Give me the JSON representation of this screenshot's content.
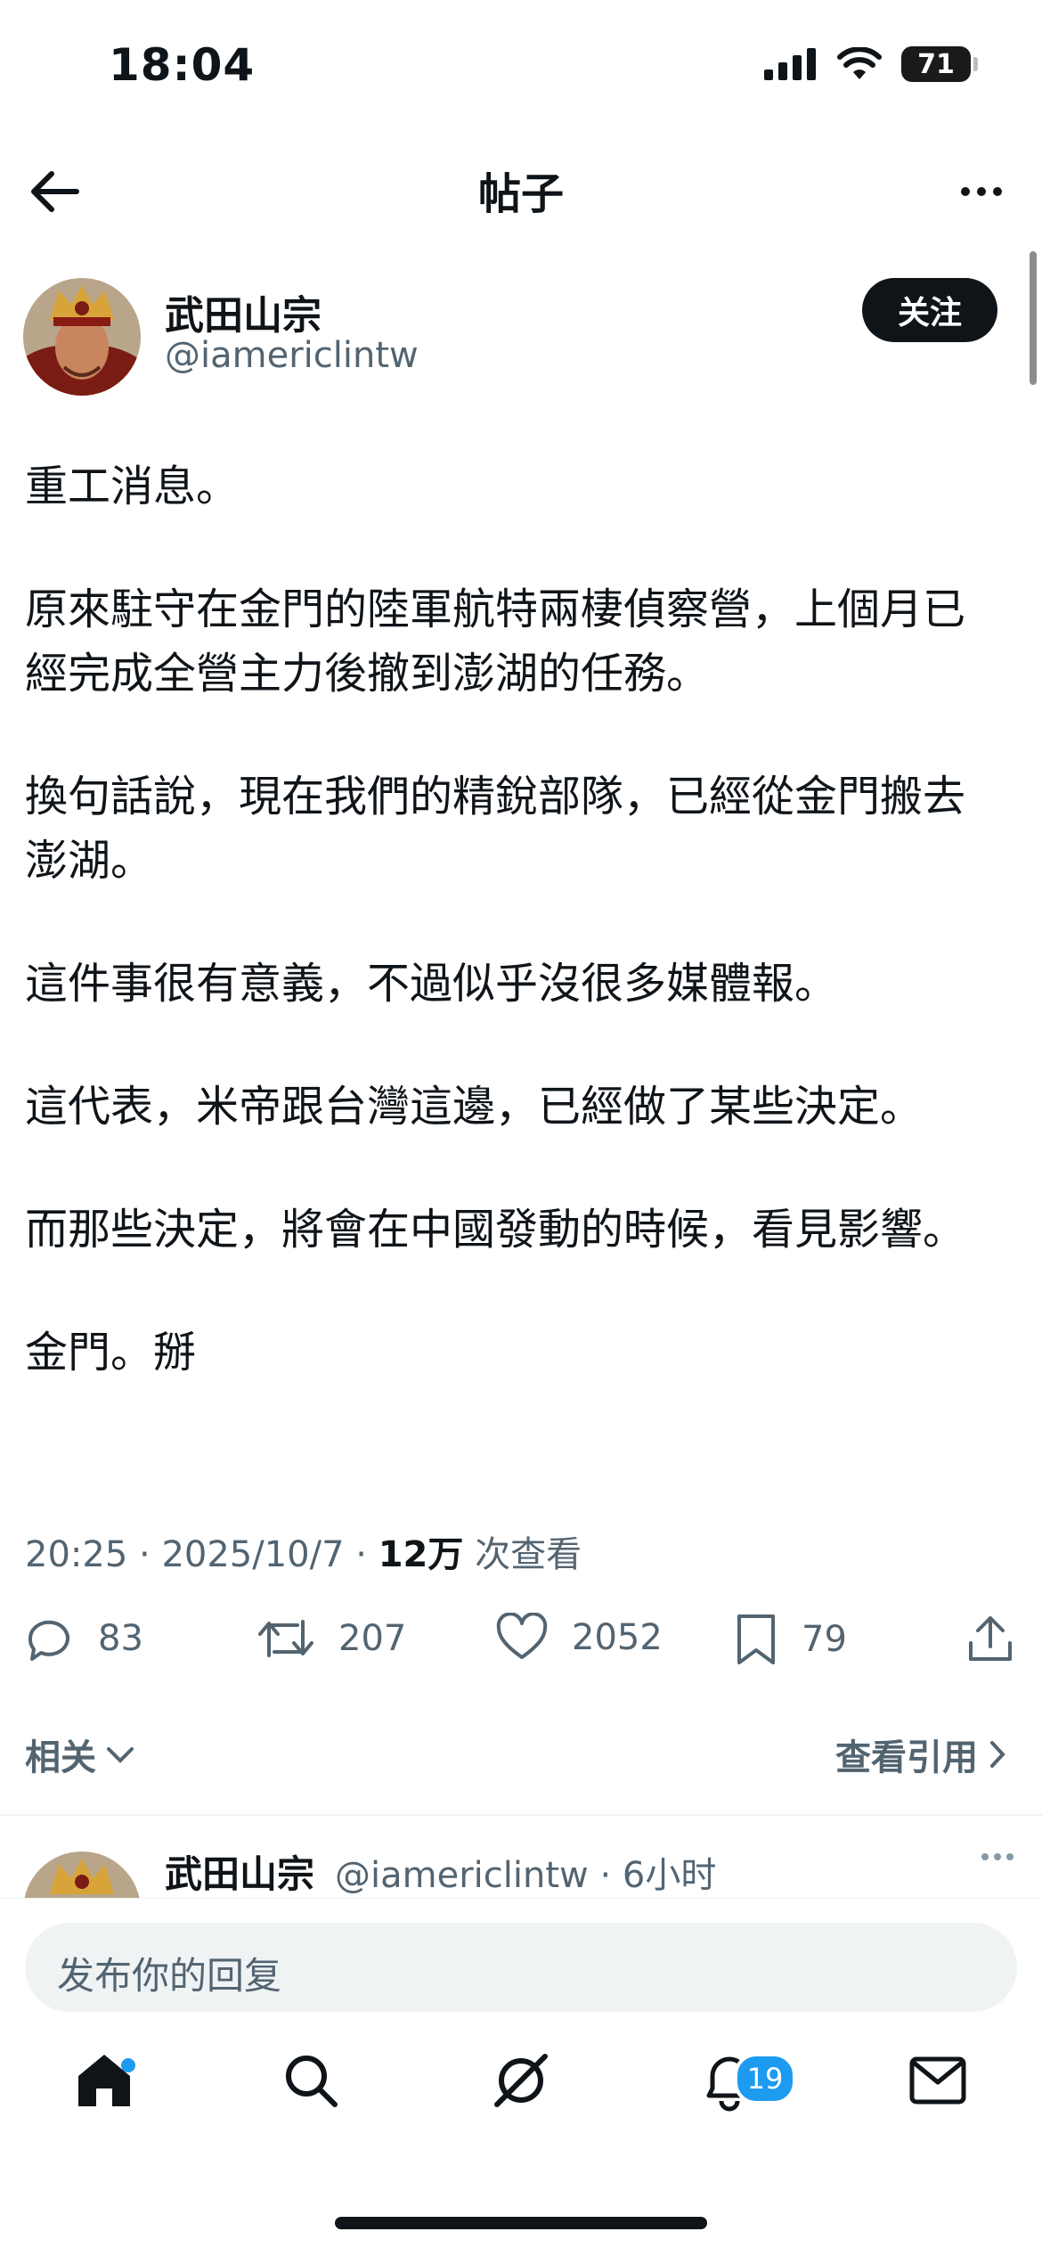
{
  "status_bar": {
    "time": "18:04",
    "battery": "71"
  },
  "header": {
    "title": "帖子"
  },
  "author": {
    "name": "武田山宗",
    "handle": "@iamericlintw",
    "follow_label": "关注"
  },
  "post": {
    "paragraphs": [
      "重工消息。",
      "原來駐守在金門的陸軍航特兩棲偵察營，上個月已經完成全營主力後撤到澎湖的任務。",
      "換句話說，現在我們的精銳部隊，已經從金門搬去澎湖。",
      "這件事很有意義，不過似乎沒很多媒體報。",
      "這代表，米帝跟台灣這邊，已經做了某些決定。",
      "而那些決定，將會在中國發動的時候，看見影響。",
      "金門。掰"
    ],
    "time": "20:25",
    "date": "2025/10/7",
    "views": "12万",
    "views_label": "次查看"
  },
  "actions": {
    "replies": "83",
    "reposts": "207",
    "likes": "2052",
    "bookmarks": "79"
  },
  "links": {
    "related": "相关",
    "quotes": "查看引用"
  },
  "reply": {
    "name": "武田山宗",
    "handle": "@iamericlintw · 6小时"
  },
  "composer": {
    "placeholder": "发布你的回复"
  },
  "tabbar": {
    "notifications_count": "19"
  },
  "colors": {
    "accent": "#1d9bf0",
    "text": "#0f1419",
    "secondary": "#536471"
  }
}
